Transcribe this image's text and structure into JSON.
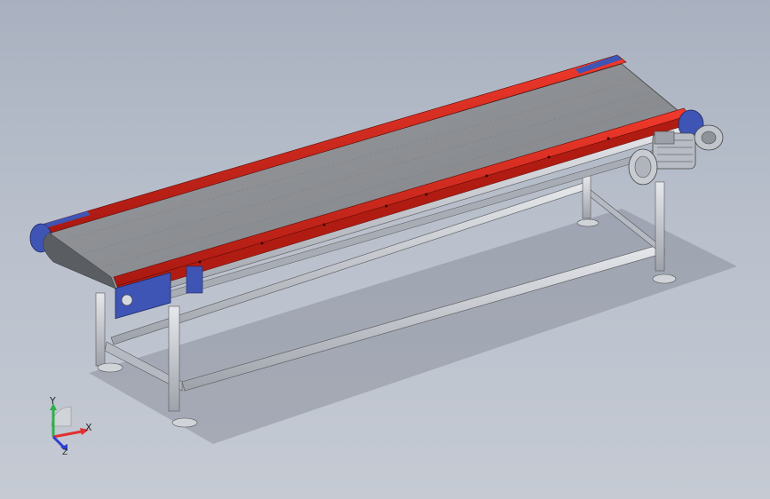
{
  "viewport": {
    "background_top": "#a9b1c0",
    "background_bottom": "#c5cad3"
  },
  "model": {
    "belt_color": "#8f9296",
    "side_rail_color": "#d8261c",
    "frame_color": "#c9ccd2",
    "end_plate_color": "#3f55b5",
    "motor_color": "#b8bcc4"
  },
  "triad": {
    "x_label": "X",
    "y_label": "Y",
    "z_label": "Z",
    "x_color": "#e03030",
    "y_color": "#2fb04a",
    "z_color": "#2c3fd0"
  }
}
